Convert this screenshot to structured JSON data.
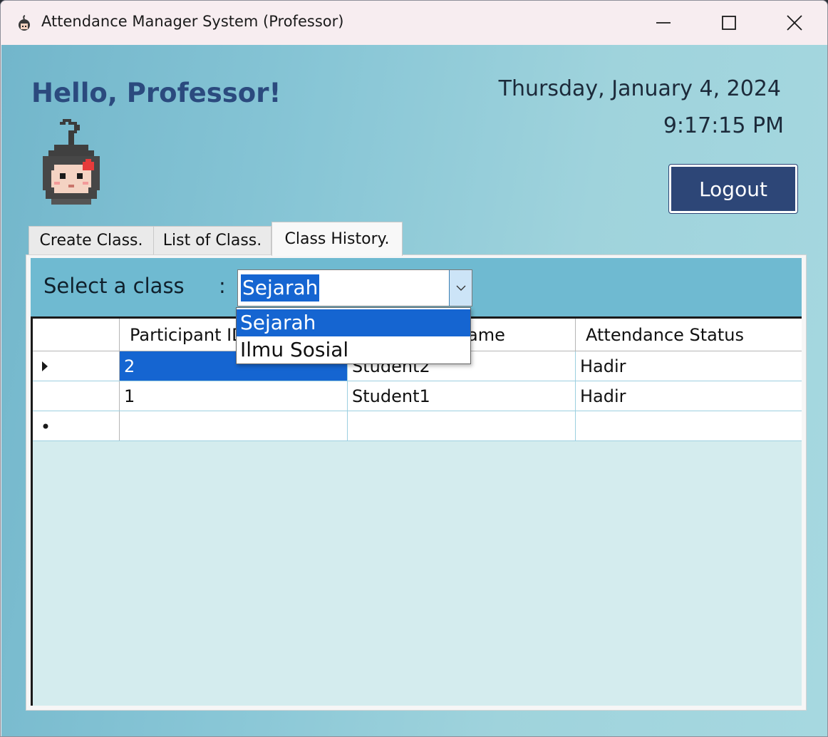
{
  "window": {
    "title": "Attendance Manager System (Professor)",
    "icons": {
      "app": "avatar-icon",
      "minimize": "minimize-icon",
      "maximize": "maximize-icon",
      "close": "close-icon"
    }
  },
  "header": {
    "greeting": "Hello, Professor!",
    "date": "Thursday, January 4, 2024",
    "time": "9:17:15 PM",
    "logout_label": "Logout"
  },
  "tabs": [
    {
      "label": "Create Class."
    },
    {
      "label": "List of Class."
    },
    {
      "label": "Class History.",
      "active": true
    }
  ],
  "class_select": {
    "label": "Select a class",
    "separator": ":",
    "selected": "Sejarah",
    "options": [
      "Sejarah",
      "Ilmu Sosial"
    ]
  },
  "grid": {
    "columns": [
      "Participant ID",
      "Participant Name",
      "Attendance Status"
    ],
    "rows": [
      {
        "id": "2",
        "name": "Student2",
        "status": "Hadir"
      },
      {
        "id": "1",
        "name": "Student1",
        "status": "Hadir"
      }
    ]
  },
  "colors": {
    "accent": "#2d4677",
    "selection": "#1565d1",
    "select_bar": "#6fbad1",
    "greeting": "#2b4a7e"
  }
}
